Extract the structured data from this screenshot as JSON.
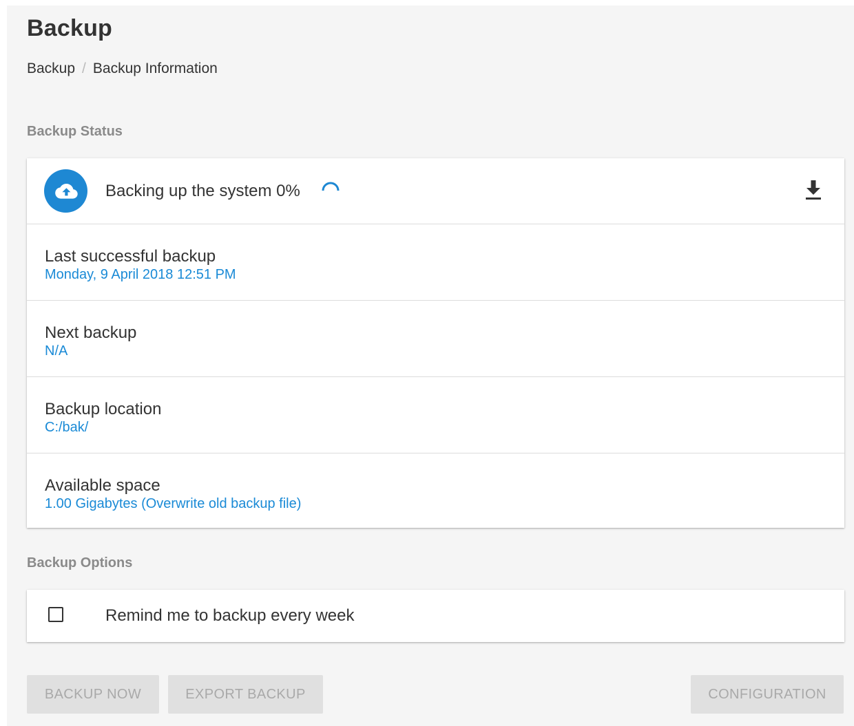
{
  "page": {
    "title": "Backup"
  },
  "breadcrumb": {
    "items": [
      "Backup",
      "Backup Information"
    ],
    "separator": "/"
  },
  "status_section": {
    "label": "Backup Status",
    "status_text": "Backing up the system 0%",
    "progress_percent": 0,
    "icons": {
      "status": "cloud-upload-icon",
      "spinner": "loading-spinner-icon",
      "action": "download-icon"
    },
    "rows": [
      {
        "label": "Last successful backup",
        "value": "Monday, 9 April 2018 12:51 PM"
      },
      {
        "label": "Next backup",
        "value": "N/A"
      },
      {
        "label": "Backup location",
        "value": "C:/bak/"
      },
      {
        "label": "Available space",
        "value": "1.00 Gigabytes (Overwrite old backup file)"
      }
    ]
  },
  "options_section": {
    "label": "Backup Options",
    "remind_weekly": {
      "label": "Remind me to backup every week",
      "checked": false
    }
  },
  "actions": {
    "backup_now": "BACKUP NOW",
    "export_backup": "EXPORT BACKUP",
    "configuration": "CONFIGURATION"
  },
  "colors": {
    "accent": "#1e88d3",
    "link_value": "#1a8ad6",
    "page_background": "#f5f5f5",
    "disabled_button_bg": "#e0e0e0",
    "disabled_button_text": "#a9a9a9"
  }
}
